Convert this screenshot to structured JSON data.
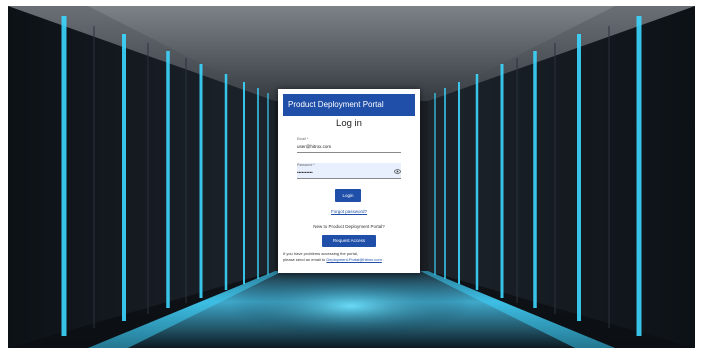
{
  "portal": {
    "header_title": "Product Deployment Portal",
    "login_title": "Log in",
    "email": {
      "label": "Email *",
      "value": "user@hitrox.com"
    },
    "password": {
      "label": "Password *",
      "value": "••••••••••",
      "toggle_icon": "eye-icon"
    },
    "login_button": "Login",
    "forgot_password": "Forgot password?",
    "new_prompt": "New to Product Deployment Portal?",
    "request_button": "Request Access",
    "problem_line1": "If you have problems accessing the portal,",
    "problem_line2_prefix": "please send an email to ",
    "support_email": "Deployment.Portal@hitrox.com"
  },
  "colors": {
    "brand": "#1f4fa8",
    "background_glow": "#26c6ff"
  }
}
